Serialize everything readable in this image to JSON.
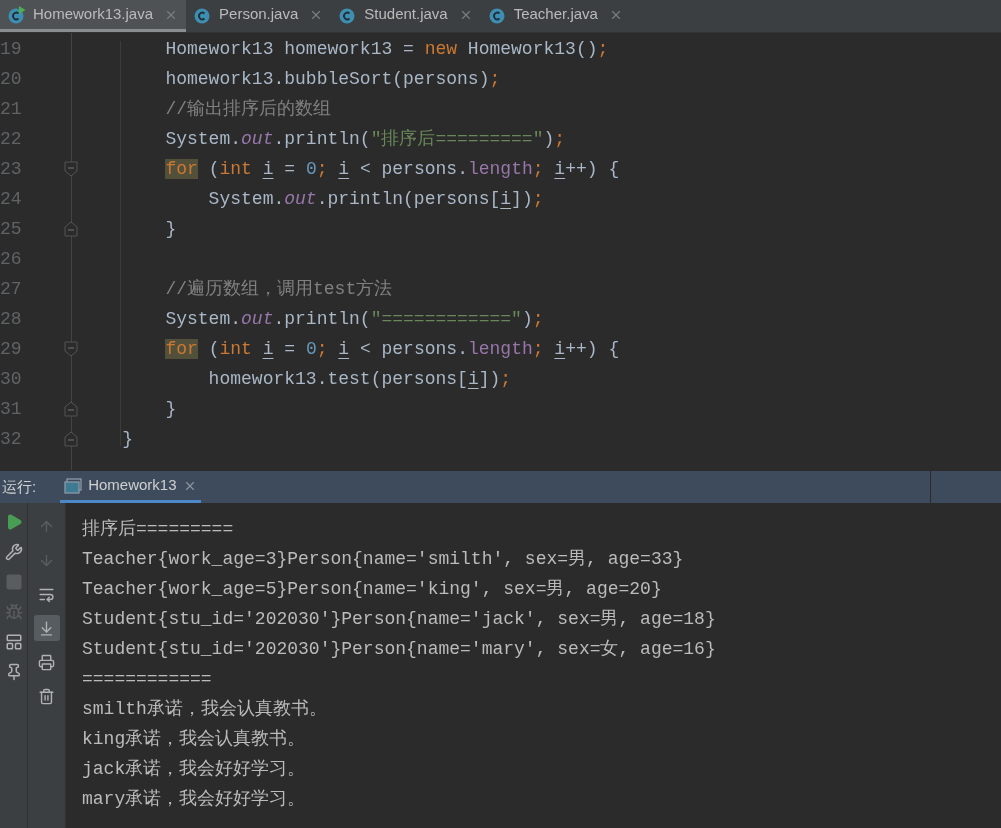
{
  "editor_tabs": [
    {
      "label": "Homework13.java",
      "selected": true,
      "running": true
    },
    {
      "label": "Person.java",
      "selected": false,
      "running": false
    },
    {
      "label": "Student.java",
      "selected": false,
      "running": false
    },
    {
      "label": "Teacher.java",
      "selected": false,
      "running": false
    }
  ],
  "code_lines": [
    {
      "number": "19",
      "kind": "plain",
      "tokens": [
        {
          "text": "        Homework13 homework13 = ",
          "kind": "plain"
        },
        {
          "text": "new",
          "kind": "keyword"
        },
        {
          "text": " Homework13()",
          "kind": "plain"
        },
        {
          "text": ";",
          "kind": "keyword"
        }
      ]
    },
    {
      "number": "20",
      "kind": "plain",
      "tokens": [
        {
          "text": "        homework13.bubbleSort(persons)",
          "kind": "plain"
        },
        {
          "text": ";",
          "kind": "keyword"
        }
      ]
    },
    {
      "number": "21",
      "kind": "plain",
      "tokens": [
        {
          "text": "        //输出排序后的数组",
          "kind": "comment"
        }
      ]
    },
    {
      "number": "22",
      "kind": "plain",
      "tokens": [
        {
          "text": "        System.",
          "kind": "plain"
        },
        {
          "text": "out",
          "kind": "static"
        },
        {
          "text": ".println(",
          "kind": "plain"
        },
        {
          "text": "\"排序后=========\"",
          "kind": "string"
        },
        {
          "text": ")",
          "kind": "plain"
        },
        {
          "text": ";",
          "kind": "keyword"
        }
      ]
    },
    {
      "number": "23",
      "kind": "fold_start",
      "tokens": [
        {
          "text": "        for",
          "kind": "keyword_marked"
        },
        {
          "text": " (",
          "kind": "plain"
        },
        {
          "text": "int ",
          "kind": "keyword"
        },
        {
          "text": "i",
          "kind": "variable"
        },
        {
          "text": " = ",
          "kind": "plain"
        },
        {
          "text": "0",
          "kind": "number"
        },
        {
          "text": "; ",
          "kind": "keyword"
        },
        {
          "text": "i",
          "kind": "variable"
        },
        {
          "text": " < persons.",
          "kind": "plain"
        },
        {
          "text": "length",
          "kind": "field"
        },
        {
          "text": "; ",
          "kind": "keyword"
        },
        {
          "text": "i",
          "kind": "variable"
        },
        {
          "text": "++) {",
          "kind": "plain"
        }
      ]
    },
    {
      "number": "24",
      "kind": "plain",
      "tokens": [
        {
          "text": "            System.",
          "kind": "plain"
        },
        {
          "text": "out",
          "kind": "static"
        },
        {
          "text": ".println(persons[",
          "kind": "plain"
        },
        {
          "text": "i",
          "kind": "variable"
        },
        {
          "text": "])",
          "kind": "plain"
        },
        {
          "text": ";",
          "kind": "keyword"
        }
      ]
    },
    {
      "number": "25",
      "kind": "fold_end",
      "tokens": [
        {
          "text": "        }",
          "kind": "plain"
        }
      ]
    },
    {
      "number": "26",
      "kind": "plain"
    },
    {
      "number": "27",
      "kind": "plain",
      "tokens": [
        {
          "text": "        //遍历数组，调用test方法",
          "kind": "comment"
        }
      ]
    },
    {
      "number": "28",
      "kind": "plain",
      "tokens": [
        {
          "text": "        System.",
          "kind": "plain"
        },
        {
          "text": "out",
          "kind": "static"
        },
        {
          "text": ".println(",
          "kind": "plain"
        },
        {
          "text": "\"============\"",
          "kind": "string"
        },
        {
          "text": ")",
          "kind": "plain"
        },
        {
          "text": ";",
          "kind": "keyword"
        }
      ]
    },
    {
      "number": "29",
      "kind": "fold_start",
      "tokens": [
        {
          "text": "        for",
          "kind": "keyword_marked"
        },
        {
          "text": " (",
          "kind": "plain"
        },
        {
          "text": "int ",
          "kind": "keyword"
        },
        {
          "text": "i",
          "kind": "variable"
        },
        {
          "text": " = ",
          "kind": "plain"
        },
        {
          "text": "0",
          "kind": "number"
        },
        {
          "text": "; ",
          "kind": "keyword"
        },
        {
          "text": "i",
          "kind": "variable"
        },
        {
          "text": " < persons.",
          "kind": "plain"
        },
        {
          "text": "length",
          "kind": "field"
        },
        {
          "text": "; ",
          "kind": "keyword"
        },
        {
          "text": "i",
          "kind": "variable"
        },
        {
          "text": "++) {",
          "kind": "plain"
        }
      ]
    },
    {
      "number": "30",
      "kind": "plain",
      "tokens": [
        {
          "text": "            homework13.test(persons[",
          "kind": "plain"
        },
        {
          "text": "i",
          "kind": "variable"
        },
        {
          "text": "])",
          "kind": "plain"
        },
        {
          "text": ";",
          "kind": "keyword"
        }
      ]
    },
    {
      "number": "31",
      "kind": "fold_end",
      "tokens": [
        {
          "text": "        }",
          "kind": "plain"
        }
      ]
    },
    {
      "number": "32",
      "kind": "fold_end",
      "tokens": [
        {
          "text": "    }",
          "kind": "plain"
        }
      ]
    }
  ],
  "run_panel": {
    "label": "运行:",
    "tabs": [
      {
        "label": "Homework13",
        "selected": true
      }
    ],
    "left_toolbar": [
      {
        "kind": "run",
        "disabled": false
      },
      {
        "kind": "wrench",
        "disabled": false
      },
      {
        "kind": "stop",
        "disabled": true
      },
      {
        "kind": "debug",
        "disabled": true
      },
      {
        "kind": "layout",
        "disabled": false
      },
      {
        "kind": "pin",
        "disabled": false
      }
    ],
    "console_toolbar": [
      {
        "kind": "up",
        "disabled": true,
        "selected": false
      },
      {
        "kind": "down",
        "disabled": true,
        "selected": false
      },
      {
        "kind": "wrap",
        "disabled": false,
        "selected": false
      },
      {
        "kind": "scroll_end",
        "disabled": false,
        "selected": true
      },
      {
        "kind": "print",
        "disabled": false,
        "selected": false
      },
      {
        "kind": "trash",
        "disabled": false,
        "selected": false
      }
    ],
    "console_lines": [
      "排序后=========",
      "Teacher{work_age=3}Person{name='smilth', sex=男, age=33}",
      "Teacher{work_age=5}Person{name='king', sex=男, age=20}",
      "Student{stu_id='202030'}Person{name='jack', sex=男, age=18}",
      "Student{stu_id='202030'}Person{name='mary', sex=女, age=16}",
      "============",
      "smilth承诺，我会认真教书。",
      "king承诺，我会认真教书。",
      "jack承诺，我会好好学习。",
      "mary承诺，我会好好学习。"
    ]
  }
}
